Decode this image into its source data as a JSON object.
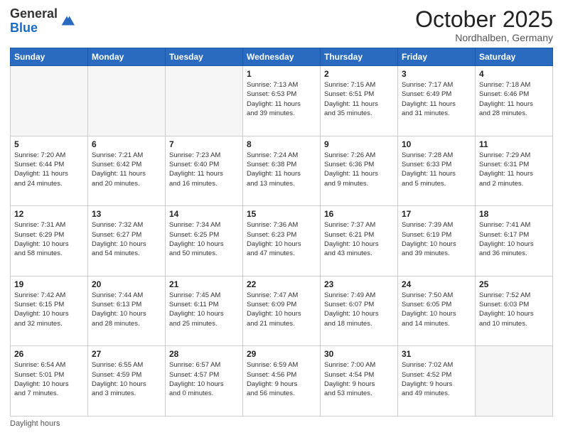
{
  "header": {
    "logo_general": "General",
    "logo_blue": "Blue",
    "month": "October 2025",
    "location": "Nordhalben, Germany"
  },
  "days_of_week": [
    "Sunday",
    "Monday",
    "Tuesday",
    "Wednesday",
    "Thursday",
    "Friday",
    "Saturday"
  ],
  "footer": {
    "label": "Daylight hours"
  },
  "weeks": [
    [
      {
        "day": "",
        "info": ""
      },
      {
        "day": "",
        "info": ""
      },
      {
        "day": "",
        "info": ""
      },
      {
        "day": "1",
        "info": "Sunrise: 7:13 AM\nSunset: 6:53 PM\nDaylight: 11 hours\nand 39 minutes."
      },
      {
        "day": "2",
        "info": "Sunrise: 7:15 AM\nSunset: 6:51 PM\nDaylight: 11 hours\nand 35 minutes."
      },
      {
        "day": "3",
        "info": "Sunrise: 7:17 AM\nSunset: 6:49 PM\nDaylight: 11 hours\nand 31 minutes."
      },
      {
        "day": "4",
        "info": "Sunrise: 7:18 AM\nSunset: 6:46 PM\nDaylight: 11 hours\nand 28 minutes."
      }
    ],
    [
      {
        "day": "5",
        "info": "Sunrise: 7:20 AM\nSunset: 6:44 PM\nDaylight: 11 hours\nand 24 minutes."
      },
      {
        "day": "6",
        "info": "Sunrise: 7:21 AM\nSunset: 6:42 PM\nDaylight: 11 hours\nand 20 minutes."
      },
      {
        "day": "7",
        "info": "Sunrise: 7:23 AM\nSunset: 6:40 PM\nDaylight: 11 hours\nand 16 minutes."
      },
      {
        "day": "8",
        "info": "Sunrise: 7:24 AM\nSunset: 6:38 PM\nDaylight: 11 hours\nand 13 minutes."
      },
      {
        "day": "9",
        "info": "Sunrise: 7:26 AM\nSunset: 6:36 PM\nDaylight: 11 hours\nand 9 minutes."
      },
      {
        "day": "10",
        "info": "Sunrise: 7:28 AM\nSunset: 6:33 PM\nDaylight: 11 hours\nand 5 minutes."
      },
      {
        "day": "11",
        "info": "Sunrise: 7:29 AM\nSunset: 6:31 PM\nDaylight: 11 hours\nand 2 minutes."
      }
    ],
    [
      {
        "day": "12",
        "info": "Sunrise: 7:31 AM\nSunset: 6:29 PM\nDaylight: 10 hours\nand 58 minutes."
      },
      {
        "day": "13",
        "info": "Sunrise: 7:32 AM\nSunset: 6:27 PM\nDaylight: 10 hours\nand 54 minutes."
      },
      {
        "day": "14",
        "info": "Sunrise: 7:34 AM\nSunset: 6:25 PM\nDaylight: 10 hours\nand 50 minutes."
      },
      {
        "day": "15",
        "info": "Sunrise: 7:36 AM\nSunset: 6:23 PM\nDaylight: 10 hours\nand 47 minutes."
      },
      {
        "day": "16",
        "info": "Sunrise: 7:37 AM\nSunset: 6:21 PM\nDaylight: 10 hours\nand 43 minutes."
      },
      {
        "day": "17",
        "info": "Sunrise: 7:39 AM\nSunset: 6:19 PM\nDaylight: 10 hours\nand 39 minutes."
      },
      {
        "day": "18",
        "info": "Sunrise: 7:41 AM\nSunset: 6:17 PM\nDaylight: 10 hours\nand 36 minutes."
      }
    ],
    [
      {
        "day": "19",
        "info": "Sunrise: 7:42 AM\nSunset: 6:15 PM\nDaylight: 10 hours\nand 32 minutes."
      },
      {
        "day": "20",
        "info": "Sunrise: 7:44 AM\nSunset: 6:13 PM\nDaylight: 10 hours\nand 28 minutes."
      },
      {
        "day": "21",
        "info": "Sunrise: 7:45 AM\nSunset: 6:11 PM\nDaylight: 10 hours\nand 25 minutes."
      },
      {
        "day": "22",
        "info": "Sunrise: 7:47 AM\nSunset: 6:09 PM\nDaylight: 10 hours\nand 21 minutes."
      },
      {
        "day": "23",
        "info": "Sunrise: 7:49 AM\nSunset: 6:07 PM\nDaylight: 10 hours\nand 18 minutes."
      },
      {
        "day": "24",
        "info": "Sunrise: 7:50 AM\nSunset: 6:05 PM\nDaylight: 10 hours\nand 14 minutes."
      },
      {
        "day": "25",
        "info": "Sunrise: 7:52 AM\nSunset: 6:03 PM\nDaylight: 10 hours\nand 10 minutes."
      }
    ],
    [
      {
        "day": "26",
        "info": "Sunrise: 6:54 AM\nSunset: 5:01 PM\nDaylight: 10 hours\nand 7 minutes."
      },
      {
        "day": "27",
        "info": "Sunrise: 6:55 AM\nSunset: 4:59 PM\nDaylight: 10 hours\nand 3 minutes."
      },
      {
        "day": "28",
        "info": "Sunrise: 6:57 AM\nSunset: 4:57 PM\nDaylight: 10 hours\nand 0 minutes."
      },
      {
        "day": "29",
        "info": "Sunrise: 6:59 AM\nSunset: 4:56 PM\nDaylight: 9 hours\nand 56 minutes."
      },
      {
        "day": "30",
        "info": "Sunrise: 7:00 AM\nSunset: 4:54 PM\nDaylight: 9 hours\nand 53 minutes."
      },
      {
        "day": "31",
        "info": "Sunrise: 7:02 AM\nSunset: 4:52 PM\nDaylight: 9 hours\nand 49 minutes."
      },
      {
        "day": "",
        "info": ""
      }
    ]
  ]
}
